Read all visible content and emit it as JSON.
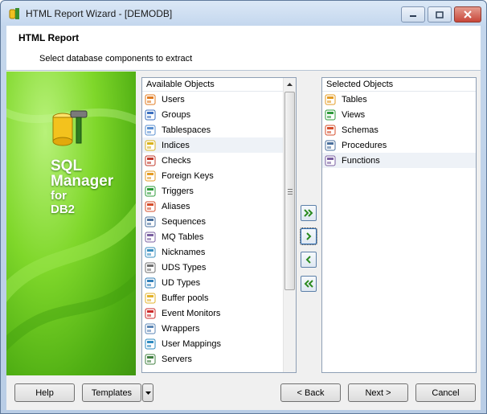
{
  "window": {
    "title": "HTML Report Wizard - [DEMODB]"
  },
  "header": {
    "title": "HTML Report",
    "subtitle": "Select database components to extract"
  },
  "banner": {
    "line1": "SQL",
    "line2": "Manager",
    "line3": "for",
    "line4": "DB2"
  },
  "available": {
    "header": "Available Objects",
    "items": [
      {
        "label": "Users",
        "icon": "users-icon"
      },
      {
        "label": "Groups",
        "icon": "groups-icon"
      },
      {
        "label": "Tablespaces",
        "icon": "tablespaces-icon"
      },
      {
        "label": "Indices",
        "icon": "indices-icon"
      },
      {
        "label": "Checks",
        "icon": "checks-icon"
      },
      {
        "label": "Foreign Keys",
        "icon": "foreign-keys-icon"
      },
      {
        "label": "Triggers",
        "icon": "triggers-icon"
      },
      {
        "label": "Aliases",
        "icon": "aliases-icon"
      },
      {
        "label": "Sequences",
        "icon": "sequences-icon"
      },
      {
        "label": "MQ Tables",
        "icon": "mq-tables-icon"
      },
      {
        "label": "Nicknames",
        "icon": "nicknames-icon"
      },
      {
        "label": "UDS Types",
        "icon": "uds-types-icon"
      },
      {
        "label": "UD Types",
        "icon": "ud-types-icon"
      },
      {
        "label": "Buffer pools",
        "icon": "buffer-pools-icon"
      },
      {
        "label": "Event Monitors",
        "icon": "event-monitors-icon"
      },
      {
        "label": "Wrappers",
        "icon": "wrappers-icon"
      },
      {
        "label": "User Mappings",
        "icon": "user-mappings-icon"
      },
      {
        "label": "Servers",
        "icon": "servers-icon"
      }
    ]
  },
  "selected": {
    "header": "Selected Objects",
    "items": [
      {
        "label": "Tables",
        "icon": "tables-icon"
      },
      {
        "label": "Views",
        "icon": "views-icon"
      },
      {
        "label": "Schemas",
        "icon": "schemas-icon"
      },
      {
        "label": "Procedures",
        "icon": "procedures-icon"
      },
      {
        "label": "Functions",
        "icon": "functions-icon"
      }
    ]
  },
  "buttons": {
    "help": "Help",
    "templates": "Templates",
    "back": "< Back",
    "next": "Next >",
    "cancel": "Cancel"
  },
  "colors": {
    "banner_green": "#5cbf1a",
    "accent_blue": "#2f6fb5"
  }
}
